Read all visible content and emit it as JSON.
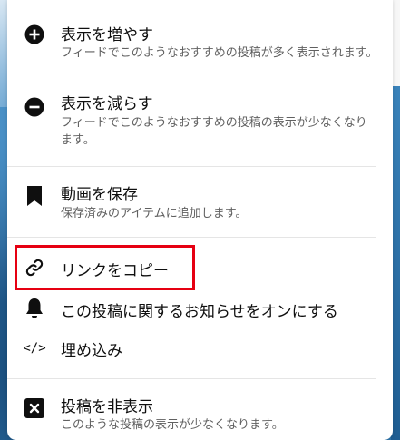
{
  "menu": {
    "items": [
      {
        "icon": "plus-circle-icon",
        "title": "表示を増やす",
        "desc": "フィードでこのようなおすすめの投稿が多く表示されます。"
      },
      {
        "icon": "minus-circle-icon",
        "title": "表示を減らす",
        "desc": "フィードでこのようなおすすめの投稿の表示が少なくなります。"
      },
      {
        "icon": "bookmark-icon",
        "title": "動画を保存",
        "desc": "保存済みのアイテムに追加します。"
      },
      {
        "icon": "link-icon",
        "title": "リンクをコピー"
      },
      {
        "icon": "bell-icon",
        "title": "この投稿に関するお知らせをオンにする"
      },
      {
        "icon": "code-icon",
        "title": "埋め込み",
        "glyph": "</>"
      },
      {
        "icon": "close-box-icon",
        "title": "投稿を非表示",
        "desc": "このような投稿の表示が少なくなります。"
      }
    ]
  },
  "colors": {
    "highlight": "#e60012",
    "icon": "#0f0f0f"
  }
}
